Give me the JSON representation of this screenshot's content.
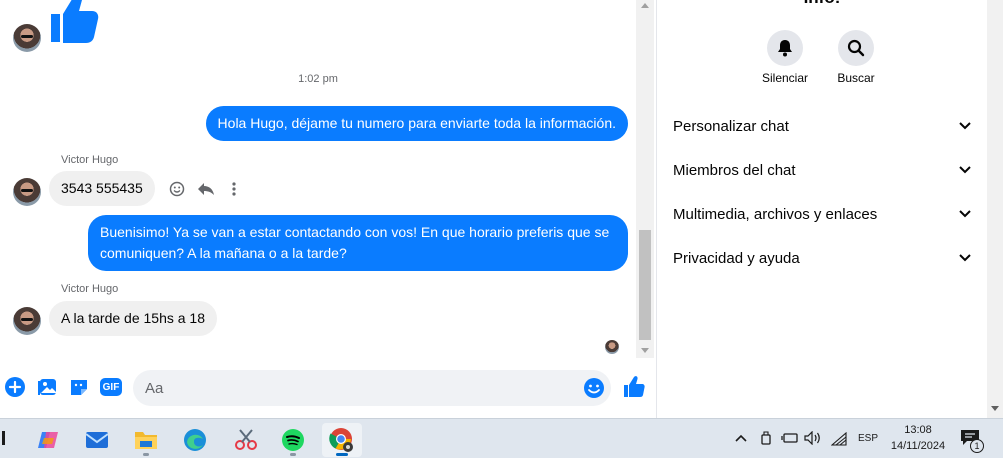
{
  "chat": {
    "timestamp": "1:02 pm",
    "messages": [
      {
        "id": "out1",
        "text": "Hola Hugo, déjame tu numero para enviarte toda la información."
      },
      {
        "id": "in1",
        "sender": "Victor Hugo",
        "text": "3543 555435"
      },
      {
        "id": "out2",
        "text": "Buenisimo! Ya se van a estar contactando con vos! En que horario preferis que se comuniquen? A la mañana o a la tarde?"
      },
      {
        "id": "in2",
        "sender": "Victor Hugo",
        "text": "A la tarde de 15hs a 18"
      }
    ],
    "message_actions": [
      "smile-icon",
      "reply-icon",
      "more-icon"
    ]
  },
  "composer": {
    "placeholder": "Aa",
    "icons": [
      "plus-icon",
      "gallery-icon",
      "sticker-icon",
      "gif-icon",
      "emoji-icon",
      "like-icon"
    ],
    "gif_label": "GIF"
  },
  "panel": {
    "title": "Info!",
    "actions": [
      {
        "label": "Silenciar",
        "icon": "bell-icon"
      },
      {
        "label": "Buscar",
        "icon": "search-icon"
      }
    ],
    "rows": [
      {
        "label": "Personalizar chat"
      },
      {
        "label": "Miembros del chat"
      },
      {
        "label": "Multimedia, archivos y enlaces"
      },
      {
        "label": "Privacidad y ayuda"
      }
    ]
  },
  "taskbar": {
    "apps": [
      "copilot-icon",
      "mail-icon",
      "file-explorer-icon",
      "edge-icon",
      "snipping-tool-icon",
      "spotify-icon",
      "chrome-icon"
    ],
    "language": "ESP",
    "time": "13:08",
    "date": "14/11/2024",
    "notification_count": "1"
  },
  "colors": {
    "accent": "#0a7cff",
    "bubble_in": "#f0f0f0",
    "taskbar": "#dfe6ee"
  }
}
